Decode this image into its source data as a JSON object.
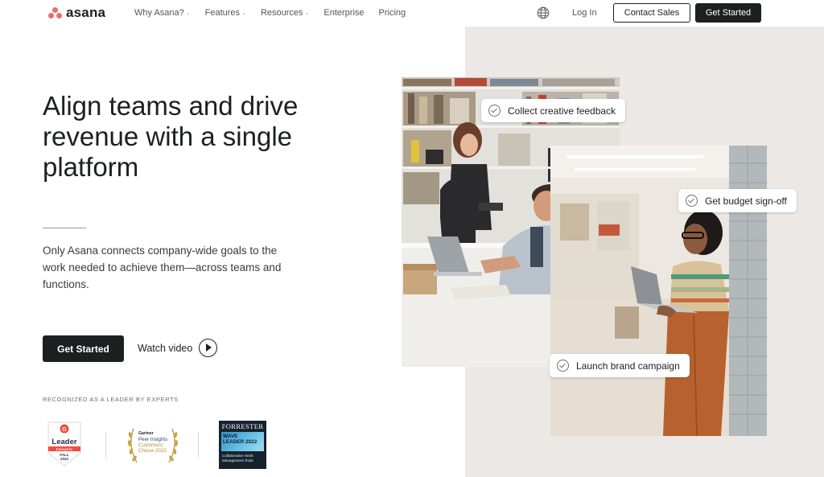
{
  "nav": {
    "logo_text": "asana",
    "links": [
      {
        "label": "Why Asana?",
        "dropdown": true
      },
      {
        "label": "Features",
        "dropdown": true
      },
      {
        "label": "Resources",
        "dropdown": true
      },
      {
        "label": "Enterprise",
        "dropdown": false
      },
      {
        "label": "Pricing",
        "dropdown": false
      }
    ],
    "language_icon": "globe-icon",
    "login_label": "Log In",
    "contact_sales_label": "Contact Sales",
    "get_started_label": "Get Started"
  },
  "hero": {
    "title": "Align teams and drive revenue with a single platform",
    "subtitle": "Only Asana connects company-wide goals to the work needed to achieve them—across teams and functions.",
    "cta_label": "Get Started",
    "watch_video_label": "Watch video",
    "recognized_label": "RECOGNIZED AS A LEADER BY EXPERTS"
  },
  "badges": {
    "g2": {
      "label": "Leader",
      "category": "Enterprise",
      "season": "FALL",
      "year": "2022"
    },
    "gartner": {
      "brand": "Gartner",
      "line1": "Peer Insights",
      "line2": "Customers'",
      "line3": "Choice 2022"
    },
    "forrester": {
      "brand": "FORRESTER",
      "line1": "WAVE",
      "line2": "LEADER 2022",
      "category": "Collaborative Work Management Tools"
    }
  },
  "chips": [
    {
      "label": "Collect creative feedback"
    },
    {
      "label": "Get budget sign-off"
    },
    {
      "label": "Launch brand campaign"
    }
  ],
  "colors": {
    "brand_coral": "#f06a6a",
    "dark": "#1e1f21",
    "panel_bg": "#ebe8e6"
  }
}
